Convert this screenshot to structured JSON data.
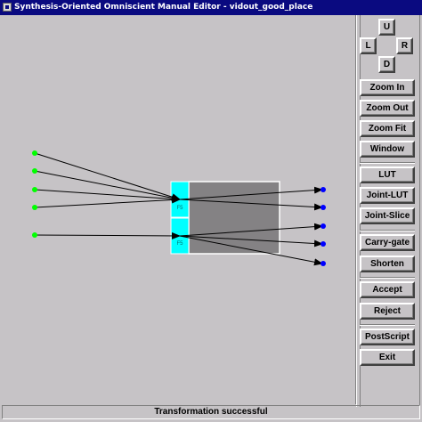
{
  "window": {
    "title": "Synthesis-Oriented Omniscient Manual Editor - vidout_good_place"
  },
  "canvas": {
    "block": {
      "label_top": "F5",
      "label_bottom": "F5",
      "colors": {
        "accent": "#00ffff",
        "body": "#848284",
        "border": "#ffffff"
      }
    },
    "colors": {
      "input_pin": "#00ff00",
      "output_pin": "#0000ff",
      "wire": "#000000"
    }
  },
  "panel": {
    "nav": {
      "up": "U",
      "left": "L",
      "right": "R",
      "down": "D"
    },
    "zoom_in": "Zoom In",
    "zoom_out": "Zoom Out",
    "zoom_fit": "Zoom Fit",
    "window": "Window",
    "lut": "LUT",
    "joint_lut": "Joint-LUT",
    "joint_slice": "Joint-Slice",
    "carry_gate": "Carry-gate",
    "shorten": "Shorten",
    "accept": "Accept",
    "reject": "Reject",
    "postscript": "PostScript",
    "exit": "Exit"
  },
  "status": {
    "message": "Transformation successful"
  }
}
